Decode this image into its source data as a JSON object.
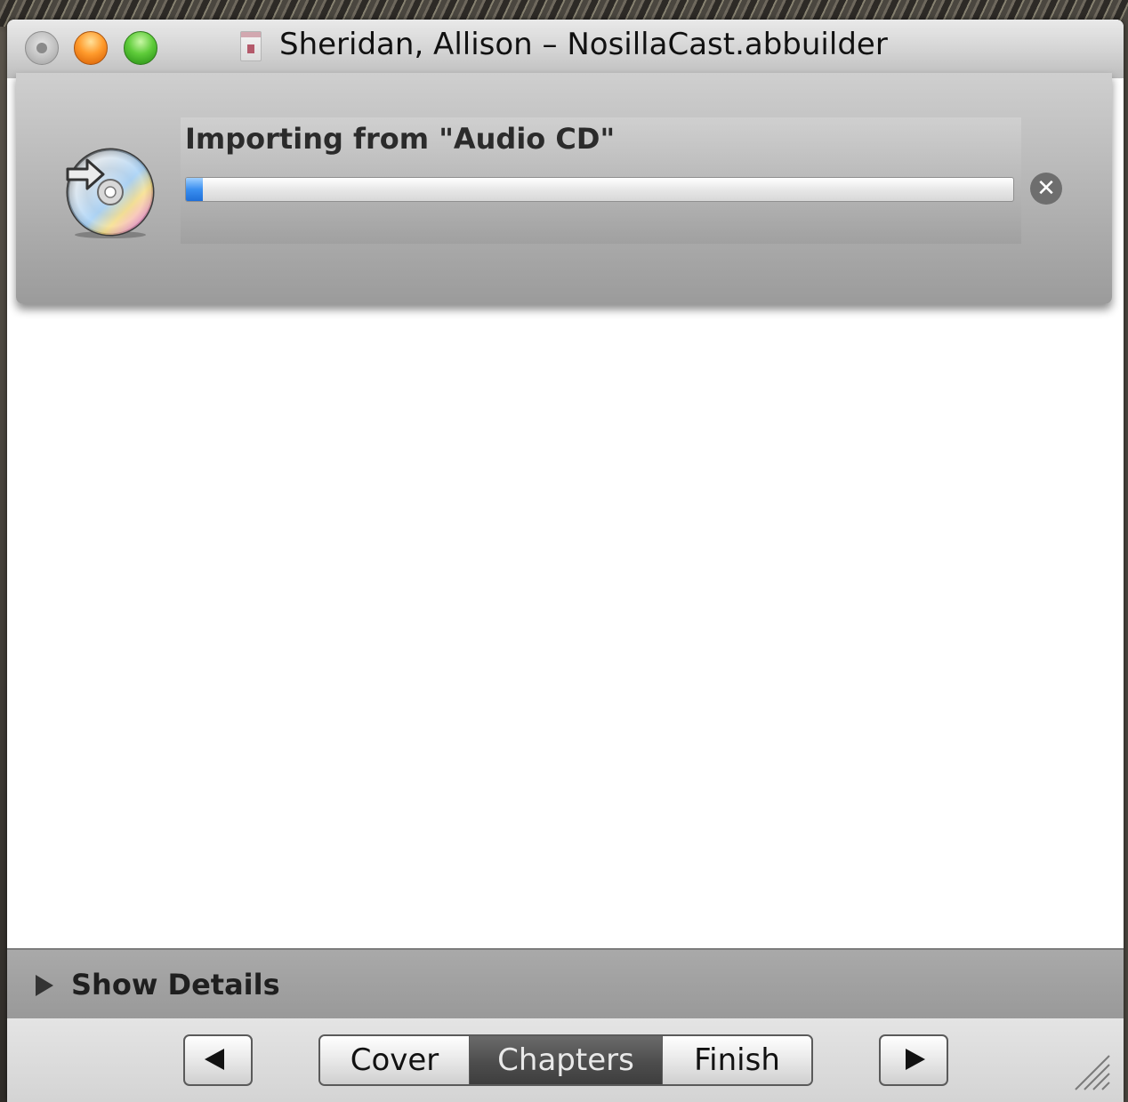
{
  "window": {
    "title": "Sheridan, Allison – NosillaCast.abbuilder"
  },
  "import_sheet": {
    "label": "Importing from \"Audio CD\"",
    "progress_percent": 2,
    "cancel_symbol": "✕",
    "icon": "cd-import-icon"
  },
  "details": {
    "label": "Show Details"
  },
  "bottom_nav": {
    "segments": [
      "Cover",
      "Chapters",
      "Finish"
    ],
    "selected": "Chapters"
  },
  "colors": {
    "progress_fill": "#2f86ef",
    "selected_segment": "#4d4d4d"
  }
}
